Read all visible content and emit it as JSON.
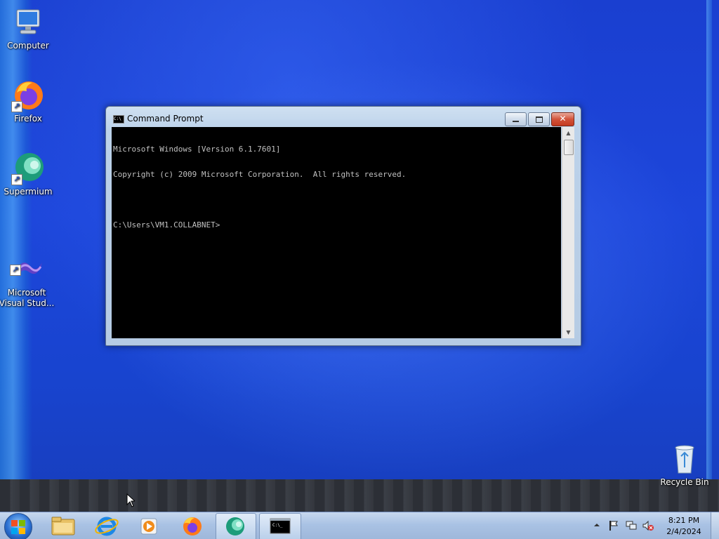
{
  "desktop": {
    "icons": [
      {
        "label": "Computer"
      },
      {
        "label": "Firefox"
      },
      {
        "label": "Supermium"
      },
      {
        "label": "Microsoft\nVisual Stud..."
      },
      {
        "label": "Recycle Bin"
      }
    ]
  },
  "window": {
    "title": "Command Prompt",
    "console_lines": [
      "Microsoft Windows [Version 6.1.7601]",
      "Copyright (c) 2009 Microsoft Corporation.  All rights reserved.",
      "",
      "C:\\Users\\VM1.COLLABNET>"
    ]
  },
  "taskbar": {
    "pinned": [
      "Windows Explorer",
      "Internet Explorer",
      "Windows Media Player",
      "Firefox",
      "Supermium",
      "Command Prompt"
    ],
    "clock": {
      "time": "8:21 PM",
      "date": "2/4/2024"
    }
  },
  "colors": {
    "desktop": "#1d46db",
    "console_bg": "#000000",
    "console_fg": "#c0c0c0",
    "close": "#c43a1f"
  }
}
